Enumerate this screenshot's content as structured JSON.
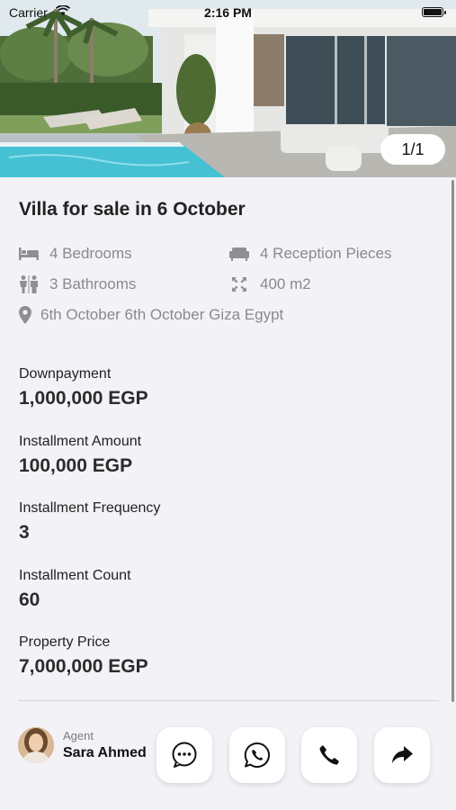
{
  "status_bar": {
    "carrier": "Carrier",
    "time": "2:16 PM"
  },
  "gallery": {
    "counter": "1/1"
  },
  "listing": {
    "title": "Villa for sale in 6 October",
    "bedrooms": "4 Bedrooms",
    "reception": "4 Reception Pieces",
    "bathrooms": "3 Bathrooms",
    "area": "400 m2",
    "location": "6th October 6th October Giza Egypt"
  },
  "details": [
    {
      "label": "Downpayment",
      "value": "1,000,000 EGP"
    },
    {
      "label": "Installment Amount",
      "value": "100,000 EGP"
    },
    {
      "label": "Installment Frequency",
      "value": "3"
    },
    {
      "label": "Installment Count",
      "value": "60"
    },
    {
      "label": "Property Price",
      "value": "7,000,000 EGP"
    }
  ],
  "agent": {
    "label": "Agent",
    "name": "Sara Ahmed"
  },
  "icons": {
    "bed": "bed-icon",
    "sofa": "sofa-icon",
    "bath": "bathroom-icon",
    "area": "expand-icon",
    "location": "map-pin-icon",
    "chat": "chat-bubble-icon",
    "whatsapp": "whatsapp-icon",
    "phone": "phone-icon",
    "share": "share-arrow-icon"
  },
  "colors": {
    "background": "#f2f2f7",
    "muted": "#8e8e93",
    "text": "#222222"
  }
}
